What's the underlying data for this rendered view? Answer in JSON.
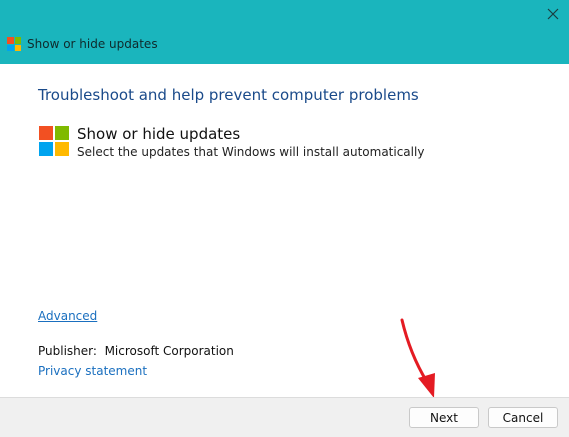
{
  "window": {
    "title": "Show or hide updates",
    "accent_color": "#1ab5bd"
  },
  "icons": {
    "app_icon": "windows-logo-icon",
    "close": "close-icon"
  },
  "main": {
    "heading": "Troubleshoot and help prevent computer problems",
    "item": {
      "title": "Show or hide updates",
      "description": "Select the updates that Windows will install automatically"
    },
    "advanced_link": "Advanced",
    "publisher_label": "Publisher:",
    "publisher_value": "Microsoft Corporation",
    "privacy_link": "Privacy statement"
  },
  "footer": {
    "next_label": "Next",
    "cancel_label": "Cancel"
  }
}
